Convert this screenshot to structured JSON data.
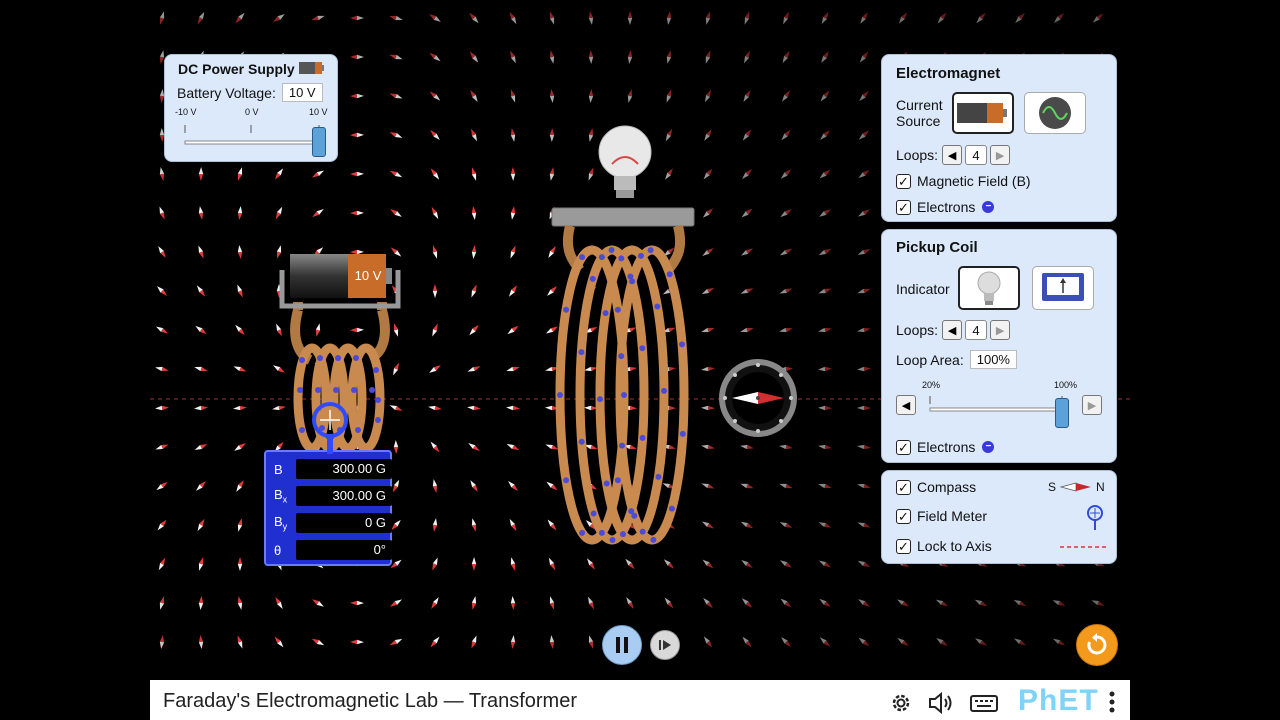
{
  "app": {
    "title": "Faraday's Electromagnetic Lab — Transformer",
    "brand": "PhET",
    "accent": "#2f5bd8"
  },
  "dc_power_supply": {
    "title": "DC Power Supply",
    "voltage_label": "Battery Voltage:",
    "voltage_value": "10 V",
    "tick_min": "-10 V",
    "tick_mid": "0 V",
    "tick_max": "10 V",
    "voltage_fraction": 1.0
  },
  "battery": {
    "label": "10 V"
  },
  "field_meter": {
    "rows": [
      {
        "label": "B",
        "sub": "",
        "value": "300.00 G"
      },
      {
        "label": "B",
        "sub": "x",
        "value": "300.00 G"
      },
      {
        "label": "B",
        "sub": "y",
        "value": "0 G"
      },
      {
        "label": "θ",
        "sub": "",
        "value": "0°"
      }
    ]
  },
  "electromagnet": {
    "title": "Electromagnet",
    "current_source_label": "Current Source",
    "loops_label": "Loops:",
    "loops_value": "4",
    "magnetic_field_label": "Magnetic Field (B)",
    "magnetic_field_checked": true,
    "electrons_label": "Electrons",
    "electrons_checked": true
  },
  "pickup_coil": {
    "title": "Pickup Coil",
    "indicator_label": "Indicator",
    "loops_label": "Loops:",
    "loops_value": "4",
    "loop_area_label": "Loop Area:",
    "loop_area_value": "100%",
    "slider_min_label": "20%",
    "slider_max_label": "100%",
    "loop_area_fraction": 1.0,
    "electrons_label": "Electrons",
    "electrons_checked": true
  },
  "view_options": {
    "compass_label": "Compass",
    "compass_checked": true,
    "compass_s": "S",
    "compass_n": "N",
    "field_meter_label": "Field Meter",
    "field_meter_checked": true,
    "lock_axis_label": "Lock to Axis",
    "lock_axis_checked": true
  },
  "icons": {
    "settings": "gear-icon",
    "audio": "speaker-icon",
    "keyboard": "keyboard-icon",
    "menu": "kebab-menu-icon",
    "reset": "reset-icon",
    "pause": "pause-icon",
    "step": "step-forward-icon"
  },
  "colors": {
    "panel_bg": "#dce9fb",
    "coil": "#c88a4e",
    "electron": "#4b4bd6",
    "field_meter_bg": "#1f2fd0",
    "reset": "#f39a1d",
    "play": "#a9cdf2"
  }
}
